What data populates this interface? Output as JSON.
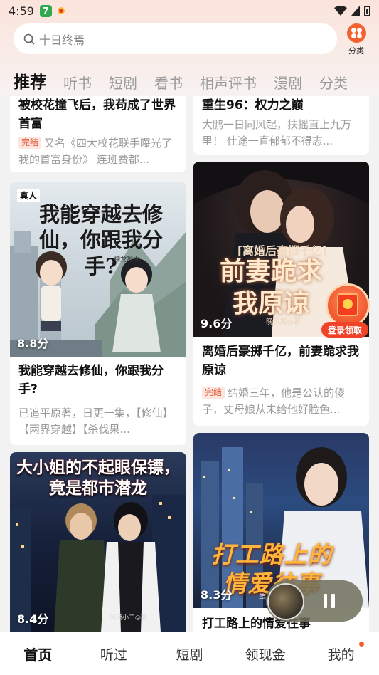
{
  "status_bar": {
    "time": "4:59",
    "app_badge": "7"
  },
  "search": {
    "placeholder": "十日终焉"
  },
  "category_button": {
    "label": "分类",
    "color": "#f2612e"
  },
  "tabs": [
    {
      "label": "推荐",
      "active": true
    },
    {
      "label": "听书"
    },
    {
      "label": "短剧"
    },
    {
      "label": "看书"
    },
    {
      "label": "相声评书"
    },
    {
      "label": "漫剧"
    },
    {
      "label": "分类"
    }
  ],
  "books": [
    {
      "title": "被校花撞飞后，我苟成了世界首富",
      "tag": "完结",
      "desc": "又名《四大校花联手曝光了我的首富身份》 连班费都..."
    },
    {
      "title": "重生96：权力之巅",
      "desc": "大鹏一日同风起，扶摇直上九万里！ 仕途一直郁郁不得志..."
    },
    {
      "title": "我能穿越去修仙，你跟我分手?",
      "cover_text": "我能穿越去修仙，你跟我分手?",
      "cover_author": "神龙啦水",
      "badge": "真人",
      "score": "8.8分",
      "desc": "已追平原著，日更一集，【修仙】【两界穿越】【杀伐果..."
    },
    {
      "title": "离婚后豪掷千亿，前妻跪求我原谅",
      "cover_subtitle": "[离婚后豪掷千亿]",
      "cover_text": "前妻跪求我原谅",
      "cover_author": "晚风笑◎著",
      "score": "9.6分",
      "tag": "完结",
      "desc": "结婚三年，他是公认的傻子，丈母娘从未给他好脸色..."
    },
    {
      "cover_text": "大小姐的不起眼保镖，竟是都市潜龙",
      "cover_author": "风流小二◎著",
      "score": "8.4分"
    },
    {
      "title": "打工路上的情爱往事",
      "cover_text": "打工路上的情爱往事",
      "cover_author": "笔",
      "score": "8.3分"
    }
  ],
  "float_gift": {
    "label": "登录领取"
  },
  "bottom_nav": [
    {
      "label": "首页",
      "active": true
    },
    {
      "label": "听过"
    },
    {
      "label": "短剧"
    },
    {
      "label": "领现金"
    },
    {
      "label": "我的",
      "dot": true
    }
  ],
  "colors": {
    "accent": "#f2612e",
    "tag_text": "#e45b3b",
    "tag_bg": "#fde6e0"
  }
}
